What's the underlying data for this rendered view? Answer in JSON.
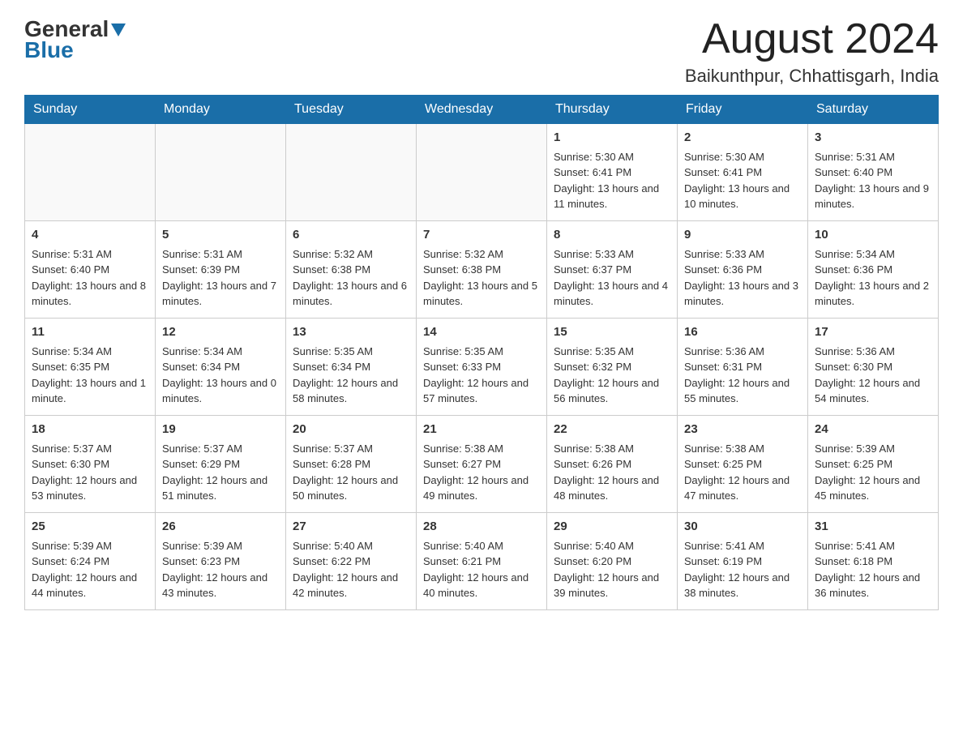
{
  "header": {
    "logo_general": "General",
    "logo_blue": "Blue",
    "month_title": "August 2024",
    "location": "Baikunthpur, Chhattisgarh, India"
  },
  "days_of_week": [
    "Sunday",
    "Monday",
    "Tuesday",
    "Wednesday",
    "Thursday",
    "Friday",
    "Saturday"
  ],
  "weeks": [
    [
      {
        "day": "",
        "sunrise": "",
        "sunset": "",
        "daylight": ""
      },
      {
        "day": "",
        "sunrise": "",
        "sunset": "",
        "daylight": ""
      },
      {
        "day": "",
        "sunrise": "",
        "sunset": "",
        "daylight": ""
      },
      {
        "day": "",
        "sunrise": "",
        "sunset": "",
        "daylight": ""
      },
      {
        "day": "1",
        "sunrise": "Sunrise: 5:30 AM",
        "sunset": "Sunset: 6:41 PM",
        "daylight": "Daylight: 13 hours and 11 minutes."
      },
      {
        "day": "2",
        "sunrise": "Sunrise: 5:30 AM",
        "sunset": "Sunset: 6:41 PM",
        "daylight": "Daylight: 13 hours and 10 minutes."
      },
      {
        "day": "3",
        "sunrise": "Sunrise: 5:31 AM",
        "sunset": "Sunset: 6:40 PM",
        "daylight": "Daylight: 13 hours and 9 minutes."
      }
    ],
    [
      {
        "day": "4",
        "sunrise": "Sunrise: 5:31 AM",
        "sunset": "Sunset: 6:40 PM",
        "daylight": "Daylight: 13 hours and 8 minutes."
      },
      {
        "day": "5",
        "sunrise": "Sunrise: 5:31 AM",
        "sunset": "Sunset: 6:39 PM",
        "daylight": "Daylight: 13 hours and 7 minutes."
      },
      {
        "day": "6",
        "sunrise": "Sunrise: 5:32 AM",
        "sunset": "Sunset: 6:38 PM",
        "daylight": "Daylight: 13 hours and 6 minutes."
      },
      {
        "day": "7",
        "sunrise": "Sunrise: 5:32 AM",
        "sunset": "Sunset: 6:38 PM",
        "daylight": "Daylight: 13 hours and 5 minutes."
      },
      {
        "day": "8",
        "sunrise": "Sunrise: 5:33 AM",
        "sunset": "Sunset: 6:37 PM",
        "daylight": "Daylight: 13 hours and 4 minutes."
      },
      {
        "day": "9",
        "sunrise": "Sunrise: 5:33 AM",
        "sunset": "Sunset: 6:36 PM",
        "daylight": "Daylight: 13 hours and 3 minutes."
      },
      {
        "day": "10",
        "sunrise": "Sunrise: 5:34 AM",
        "sunset": "Sunset: 6:36 PM",
        "daylight": "Daylight: 13 hours and 2 minutes."
      }
    ],
    [
      {
        "day": "11",
        "sunrise": "Sunrise: 5:34 AM",
        "sunset": "Sunset: 6:35 PM",
        "daylight": "Daylight: 13 hours and 1 minute."
      },
      {
        "day": "12",
        "sunrise": "Sunrise: 5:34 AM",
        "sunset": "Sunset: 6:34 PM",
        "daylight": "Daylight: 13 hours and 0 minutes."
      },
      {
        "day": "13",
        "sunrise": "Sunrise: 5:35 AM",
        "sunset": "Sunset: 6:34 PM",
        "daylight": "Daylight: 12 hours and 58 minutes."
      },
      {
        "day": "14",
        "sunrise": "Sunrise: 5:35 AM",
        "sunset": "Sunset: 6:33 PM",
        "daylight": "Daylight: 12 hours and 57 minutes."
      },
      {
        "day": "15",
        "sunrise": "Sunrise: 5:35 AM",
        "sunset": "Sunset: 6:32 PM",
        "daylight": "Daylight: 12 hours and 56 minutes."
      },
      {
        "day": "16",
        "sunrise": "Sunrise: 5:36 AM",
        "sunset": "Sunset: 6:31 PM",
        "daylight": "Daylight: 12 hours and 55 minutes."
      },
      {
        "day": "17",
        "sunrise": "Sunrise: 5:36 AM",
        "sunset": "Sunset: 6:30 PM",
        "daylight": "Daylight: 12 hours and 54 minutes."
      }
    ],
    [
      {
        "day": "18",
        "sunrise": "Sunrise: 5:37 AM",
        "sunset": "Sunset: 6:30 PM",
        "daylight": "Daylight: 12 hours and 53 minutes."
      },
      {
        "day": "19",
        "sunrise": "Sunrise: 5:37 AM",
        "sunset": "Sunset: 6:29 PM",
        "daylight": "Daylight: 12 hours and 51 minutes."
      },
      {
        "day": "20",
        "sunrise": "Sunrise: 5:37 AM",
        "sunset": "Sunset: 6:28 PM",
        "daylight": "Daylight: 12 hours and 50 minutes."
      },
      {
        "day": "21",
        "sunrise": "Sunrise: 5:38 AM",
        "sunset": "Sunset: 6:27 PM",
        "daylight": "Daylight: 12 hours and 49 minutes."
      },
      {
        "day": "22",
        "sunrise": "Sunrise: 5:38 AM",
        "sunset": "Sunset: 6:26 PM",
        "daylight": "Daylight: 12 hours and 48 minutes."
      },
      {
        "day": "23",
        "sunrise": "Sunrise: 5:38 AM",
        "sunset": "Sunset: 6:25 PM",
        "daylight": "Daylight: 12 hours and 47 minutes."
      },
      {
        "day": "24",
        "sunrise": "Sunrise: 5:39 AM",
        "sunset": "Sunset: 6:25 PM",
        "daylight": "Daylight: 12 hours and 45 minutes."
      }
    ],
    [
      {
        "day": "25",
        "sunrise": "Sunrise: 5:39 AM",
        "sunset": "Sunset: 6:24 PM",
        "daylight": "Daylight: 12 hours and 44 minutes."
      },
      {
        "day": "26",
        "sunrise": "Sunrise: 5:39 AM",
        "sunset": "Sunset: 6:23 PM",
        "daylight": "Daylight: 12 hours and 43 minutes."
      },
      {
        "day": "27",
        "sunrise": "Sunrise: 5:40 AM",
        "sunset": "Sunset: 6:22 PM",
        "daylight": "Daylight: 12 hours and 42 minutes."
      },
      {
        "day": "28",
        "sunrise": "Sunrise: 5:40 AM",
        "sunset": "Sunset: 6:21 PM",
        "daylight": "Daylight: 12 hours and 40 minutes."
      },
      {
        "day": "29",
        "sunrise": "Sunrise: 5:40 AM",
        "sunset": "Sunset: 6:20 PM",
        "daylight": "Daylight: 12 hours and 39 minutes."
      },
      {
        "day": "30",
        "sunrise": "Sunrise: 5:41 AM",
        "sunset": "Sunset: 6:19 PM",
        "daylight": "Daylight: 12 hours and 38 minutes."
      },
      {
        "day": "31",
        "sunrise": "Sunrise: 5:41 AM",
        "sunset": "Sunset: 6:18 PM",
        "daylight": "Daylight: 12 hours and 36 minutes."
      }
    ]
  ]
}
